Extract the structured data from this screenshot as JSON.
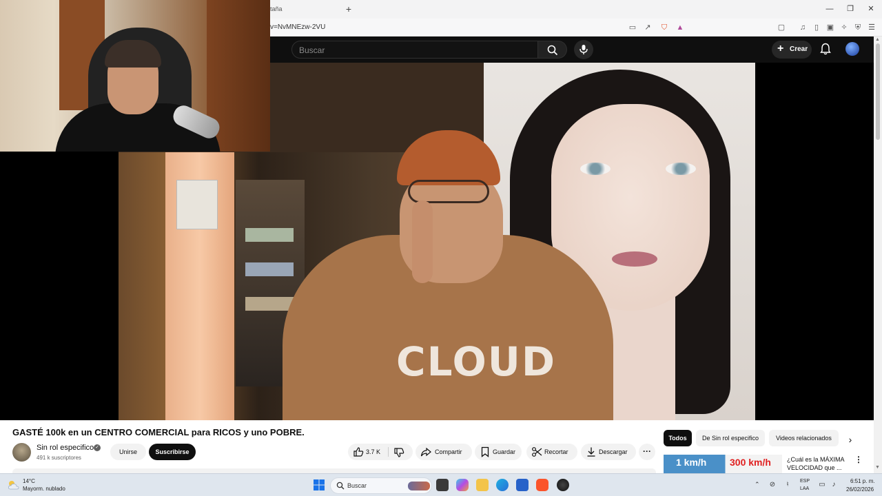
{
  "browser": {
    "tab_title": "taña",
    "new_tab": "+",
    "url": "v=NvMNEzw-2VU",
    "window_controls": {
      "minimize": "—",
      "restore": "❐",
      "close": "✕"
    }
  },
  "youtube": {
    "search": {
      "placeholder": "Buscar"
    },
    "create_label": "Crear",
    "video": {
      "title": "GASTÉ 100k en un CENTRO COMERCIAL para RICOS y uno POBRE.",
      "hoodie_text": "CLOUD",
      "channel": {
        "name": "Sin rol especifico",
        "subscribers": "491 k suscriptores"
      },
      "join_label": "Unirse",
      "subscribe_label": "Suscribirse",
      "likes": "3.7 K",
      "actions": {
        "share": "Compartir",
        "save": "Guardar",
        "clip": "Recortar",
        "download": "Descargar"
      }
    },
    "chips": [
      "Todos",
      "De Sin rol especifico",
      "Videos relacionados"
    ],
    "related": {
      "thumb_left": "1 km/h",
      "thumb_right": "300 km/h",
      "title": "¿Cuál es la MÁXIMA VELOCIDAD que ..."
    }
  },
  "taskbar": {
    "weather": {
      "temp": "14°C",
      "desc": "Mayorm. nublado"
    },
    "search_label": "Buscar",
    "lang": {
      "line1": "ESP",
      "line2": "LAA"
    },
    "clock": {
      "time": "6:51 p. m.",
      "date": "26/02/2026"
    }
  }
}
